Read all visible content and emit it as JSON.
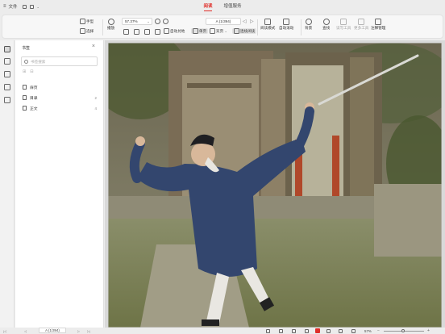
{
  "titlebar": {
    "menu_label": "文件",
    "tabs": [
      {
        "label": "阅读",
        "active": true
      },
      {
        "label": "增值服务",
        "active": false
      }
    ],
    "accent_color": "#e0302b"
  },
  "ribbon": {
    "hand_label": "手型",
    "select_label": "选择",
    "play_label": "播放",
    "zoom_value": "57.37%",
    "page_field_value": "A (1/394)",
    "auto_fit_label": "自动兑地",
    "single_page_label": "单页",
    "dual_page_label": "双页",
    "continuous_label": "连续阅读",
    "reading_mode_label": "阅读模式",
    "auto_scroll_label": "自动滚动",
    "background_label": "背景",
    "find_label": "查找",
    "tool_label": "读写工具",
    "more_label": "更多工具",
    "manage_label": "注释管理"
  },
  "panel": {
    "title": "书签",
    "search_placeholder": "书签搜索",
    "bookmarks": [
      {
        "label": "扉页",
        "count": ""
      },
      {
        "label": "目录",
        "count": "2"
      },
      {
        "label": "正文",
        "count": "4"
      }
    ]
  },
  "statusbar": {
    "page_value": "A (1/394)",
    "zoom_value": "57%"
  }
}
